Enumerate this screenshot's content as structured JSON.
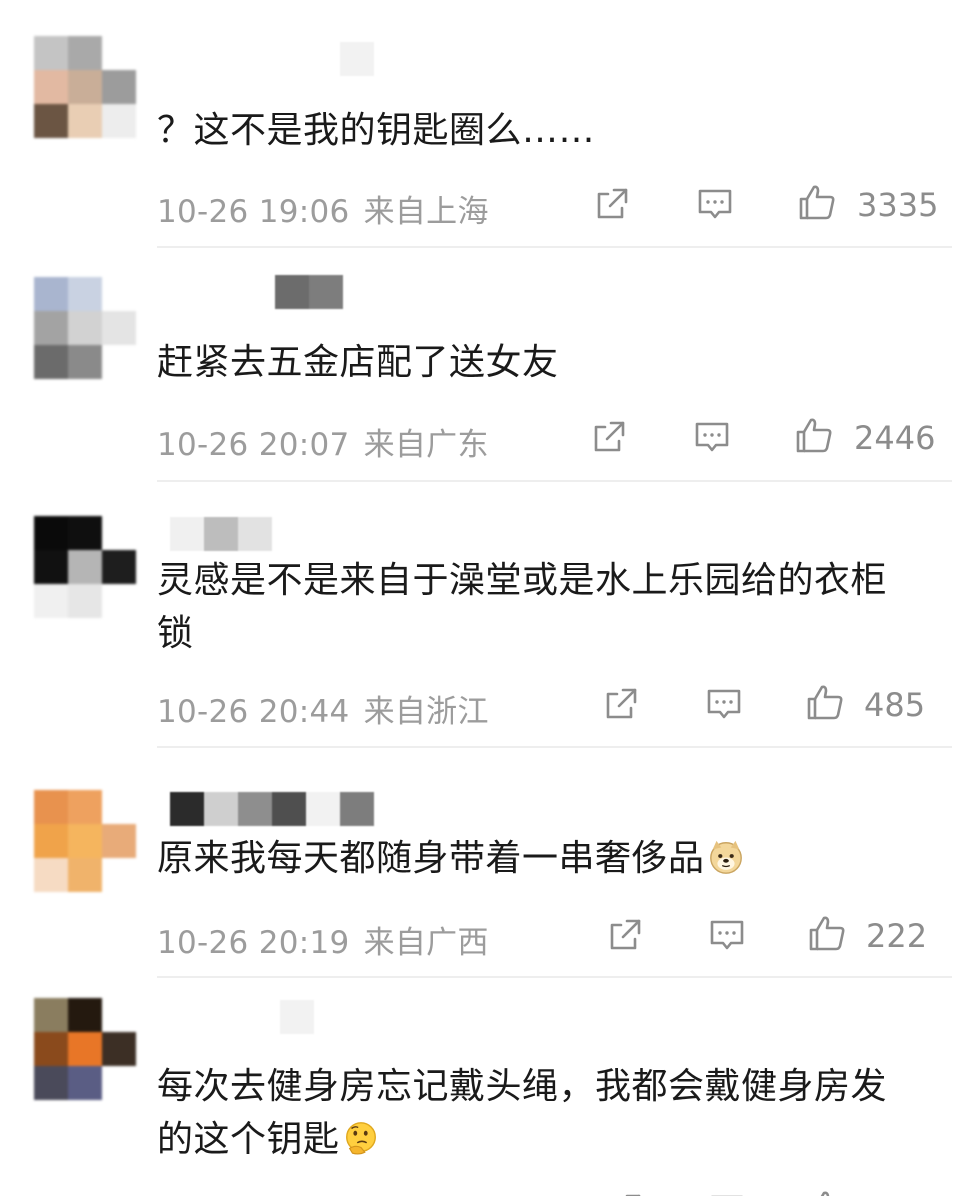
{
  "comments": [
    {
      "text": "？这不是我的钥匙圈么……",
      "date": "10-26 19:06",
      "location": "来自上海",
      "likes": "3335",
      "emoji": "",
      "avatar_colors": [
        "#c4c4c4",
        "#a9a9a9",
        "#ffffff",
        "#e2b9a2",
        "#c9ae98",
        "#9c9c9c",
        "#6b5543",
        "#e9ceb4",
        "#ededed"
      ],
      "name_blur_colors": [
        "#f2f2f2"
      ]
    },
    {
      "text": "赶紧去五金店配了送女友",
      "date": "10-26 20:07",
      "location": "来自广东",
      "likes": "2446",
      "emoji": "",
      "avatar_colors": [
        "#a9b5cf",
        "#c9d2e2",
        "#ffffff",
        "#a3a3a3",
        "#d2d2d2",
        "#e4e4e4",
        "#6b6b6b",
        "#8a8a8a",
        "#ffffff"
      ],
      "name_blur_colors": [
        "#6c6c6c",
        "#7d7d7d"
      ]
    },
    {
      "text": "灵感是不是来自于澡堂或是水上乐园给的衣柜锁",
      "date": "10-26 20:44",
      "location": "来自浙江",
      "likes": "485",
      "emoji": "",
      "avatar_colors": [
        "#0a0a0a",
        "#0f0f0f",
        "#ffffff",
        "#111111",
        "#b5b5b5",
        "#1e1e1e",
        "#f0f0f0",
        "#e6e6e6",
        "#ffffff"
      ],
      "name_blur_colors": [
        "#f0f0f0",
        "#bdbdbd",
        "#e2e2e2"
      ]
    },
    {
      "text": "原来我每天都随身带着一串奢侈品",
      "date": "10-26 20:19",
      "location": "来自广西",
      "likes": "222",
      "emoji": "doge",
      "avatar_colors": [
        "#e8924e",
        "#eea15f",
        "#ffffff",
        "#f0a34a",
        "#f5b55e",
        "#e8ab79",
        "#f6dbc3",
        "#f0b36b",
        "#ffffff"
      ],
      "name_blur_colors": [
        "#2b2b2b",
        "#cfcfcf",
        "#8e8e8e",
        "#4f4f4f",
        "#f2f2f2",
        "#7d7d7d"
      ]
    },
    {
      "text": "每次去健身房忘记戴头绳，我都会戴健身房发的这个钥匙",
      "date": "",
      "location": "",
      "likes": "",
      "emoji": "thinking",
      "avatar_colors": [
        "#8a7d5f",
        "#24190f",
        "#ffffff",
        "#8a4a1c",
        "#e87627",
        "#3c2f25",
        "#4a4a5a",
        "#5a5d84",
        "#ffffff"
      ],
      "name_blur_colors": [
        "#f2f2f2"
      ]
    }
  ],
  "icons": {
    "share": "share-icon",
    "comment": "comment-icon",
    "like": "thumbs-up-icon"
  },
  "colors": {
    "text": "#1a1a1a",
    "meta": "#9c9c9c",
    "divider": "#eeeeee",
    "icon": "#8c8c8c"
  }
}
